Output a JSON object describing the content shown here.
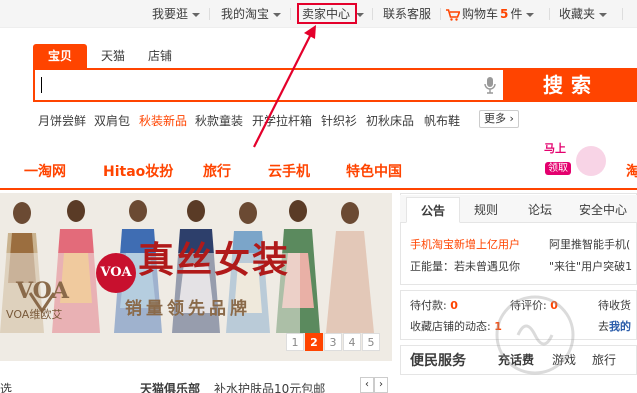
{
  "topbar": {
    "items": [
      "我要逛",
      "我的淘宝",
      "卖家中心",
      "联系客服",
      "购物车",
      "件",
      "收藏夹"
    ],
    "cart_count": "5"
  },
  "search": {
    "tabs": [
      "宝贝",
      "天猫",
      "店铺"
    ],
    "active_tab": "宝贝",
    "value": "",
    "button_label": "搜索"
  },
  "hotwords": [
    "月饼尝鲜",
    "双肩包",
    "秋装新品",
    "秋款童装",
    "开学拉杆箱",
    "针织衫",
    "初秋床品",
    "帆布鞋"
  ],
  "more_label": "更多",
  "categories": [
    "一淘网",
    "Hitao妆扮",
    "旅行",
    "云手机",
    "特色中国"
  ],
  "mashang": {
    "title": "马上",
    "sub": "领取"
  },
  "banner": {
    "brand_logo": "VOA",
    "brand_name": "VOA维欧艾",
    "badge": "VOA",
    "slogan": "真丝女装",
    "tagline": "销量领先品牌",
    "pages": [
      "1",
      "2",
      "3",
      "4",
      "5"
    ],
    "active_page": "2"
  },
  "notice": {
    "tabs": [
      "公告",
      "规则",
      "论坛",
      "安全中心"
    ],
    "lines": [
      "手机淘宝新增上亿用户",
      "阿里推智能手机(",
      "正能量：若未曾遇见你",
      "\"来往\"用户突破1"
    ]
  },
  "todo": {
    "pay_label": "待付款:",
    "pay_count": "0",
    "review_label": "待评价:",
    "review_count": "0",
    "receive_label": "待收货",
    "shop_label": "收藏店铺的动态:",
    "shop_count": "1",
    "go_label": "去",
    "mine_label": "我的"
  },
  "service": {
    "title": "便民服务",
    "tabs": [
      "充话费",
      "游戏",
      "旅行"
    ]
  },
  "bottom": {
    "left": "选",
    "club": "天猫俱乐部",
    "promo": "补水护肤品10元包邮"
  },
  "colors": {
    "accent": "#ff4400",
    "annotation": "#e4002b"
  }
}
